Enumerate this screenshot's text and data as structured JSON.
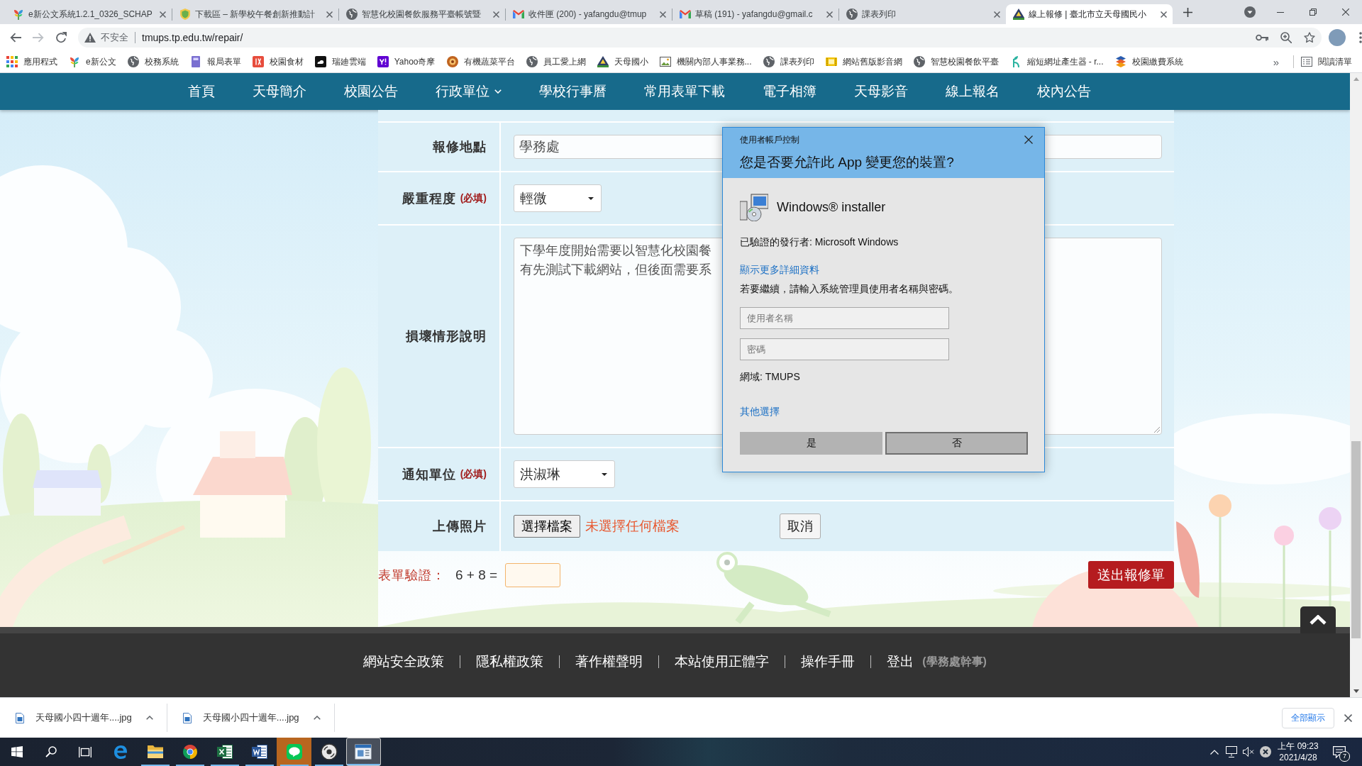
{
  "browser": {
    "tabs": [
      {
        "title": "e新公文系統1.2.1_0326_SCHAP",
        "selected": false
      },
      {
        "title": "下載區 – 新學校午餐創新推動計",
        "selected": false
      },
      {
        "title": "智慧化校園餐飲服務平臺帳號暨",
        "selected": false
      },
      {
        "title": "收件匣 (200) - yafangdu@tmup",
        "selected": false
      },
      {
        "title": "草稿 (191) - yafangdu@gmail.c",
        "selected": false
      },
      {
        "title": "課表列印",
        "selected": false
      },
      {
        "title": "線上報修 | 臺北市立天母國民小",
        "selected": true
      }
    ],
    "address_bar": {
      "security_label": "不安全",
      "url": "tmups.tp.edu.tw/repair/"
    },
    "bookmarks": [
      {
        "label": "應用程式"
      },
      {
        "label": "e新公文"
      },
      {
        "label": "校務系統"
      },
      {
        "label": "報局表單"
      },
      {
        "label": "校園食材"
      },
      {
        "label": "瑞廸雲端"
      },
      {
        "label": "Yahoo奇摩"
      },
      {
        "label": "有機蔬菜平台"
      },
      {
        "label": "員工愛上網"
      },
      {
        "label": "天母國小"
      },
      {
        "label": "機關內部人事業務..."
      },
      {
        "label": "課表列印"
      },
      {
        "label": "網站舊版影音網"
      },
      {
        "label": "智慧校園餐飲平臺"
      },
      {
        "label": "縮短網址產生器 - r..."
      },
      {
        "label": "校園繳費系統"
      }
    ],
    "bookmarks_more": "»",
    "reading_list": "閱讀清單"
  },
  "site_nav": [
    {
      "label": "首頁",
      "has_menu": false
    },
    {
      "label": "天母簡介",
      "has_menu": false
    },
    {
      "label": "校園公告",
      "has_menu": false
    },
    {
      "label": "行政單位",
      "has_menu": true
    },
    {
      "label": "學校行事曆",
      "has_menu": false
    },
    {
      "label": "常用表單下載",
      "has_menu": false
    },
    {
      "label": "電子相簿",
      "has_menu": false
    },
    {
      "label": "天母影音",
      "has_menu": false
    },
    {
      "label": "線上報名",
      "has_menu": false
    },
    {
      "label": "校內公告",
      "has_menu": false
    }
  ],
  "repair_form": {
    "rows": [
      {
        "kind": "text",
        "label": "報修地點",
        "value": "學務處"
      },
      {
        "kind": "select",
        "label": "嚴重程度",
        "note": "(必填)",
        "value": "輕微"
      },
      {
        "kind": "textarea",
        "label": "損壞情形說明",
        "lines": [
          "下學年度開始需要以智慧化校園餐",
          "有先測試下載網站，但後面需要系"
        ]
      },
      {
        "kind": "select",
        "label": "通知單位",
        "note": "(必填)",
        "value": "洪淑琳"
      },
      {
        "kind": "file",
        "label": "上傳照片",
        "button": "選擇檔案",
        "status": "未選擇任何檔案",
        "cancel": "取消"
      }
    ],
    "captcha": {
      "label": "表單驗證：",
      "question": "6 + 8 ="
    },
    "submit": "送出報修單"
  },
  "footer": {
    "links": [
      "網站安全政策",
      "隱私權政策",
      "著作權聲明",
      "本站使用正體字",
      "操作手冊",
      "登出"
    ],
    "user_role": "(學務處幹事)"
  },
  "uac_dialog": {
    "caption": "使用者帳戶控制",
    "question": "您是否要允許此 App 變更您的裝置?",
    "app_name": "Windows® installer",
    "publisher": "已驗證的發行者: Microsoft Windows",
    "details_link": "顯示更多詳細資料",
    "instruction": "若要繼續，請輸入系統管理員使用者名稱與密碼。",
    "fields": [
      {
        "placeholder": "使用者名稱"
      },
      {
        "placeholder": "密碼"
      }
    ],
    "domain": "網域: TMUPS",
    "other_link": "其他選擇",
    "buttons": [
      {
        "label": "是",
        "focused": false
      },
      {
        "label": "否",
        "focused": true
      }
    ]
  },
  "downloads_bar": {
    "items": [
      {
        "file_name": "天母國小四十週年....jpg"
      },
      {
        "file_name": "天母國小四十週年....jpg"
      }
    ],
    "show_all": "全部顯示"
  },
  "taskbar": {
    "apps": [
      {
        "running": false,
        "selected": false,
        "attention": false
      },
      {
        "running": true,
        "selected": false,
        "attention": false
      },
      {
        "running": true,
        "selected": false,
        "attention": false
      },
      {
        "running": true,
        "selected": false,
        "attention": false
      },
      {
        "running": true,
        "selected": false,
        "attention": false
      },
      {
        "running": true,
        "selected": false,
        "attention": true
      },
      {
        "running": true,
        "selected": false,
        "attention": false
      },
      {
        "running": true,
        "selected": true,
        "attention": false
      }
    ],
    "clock": {
      "time": "上午 09:23",
      "date": "2021/4/28"
    },
    "notification_count": "7"
  }
}
